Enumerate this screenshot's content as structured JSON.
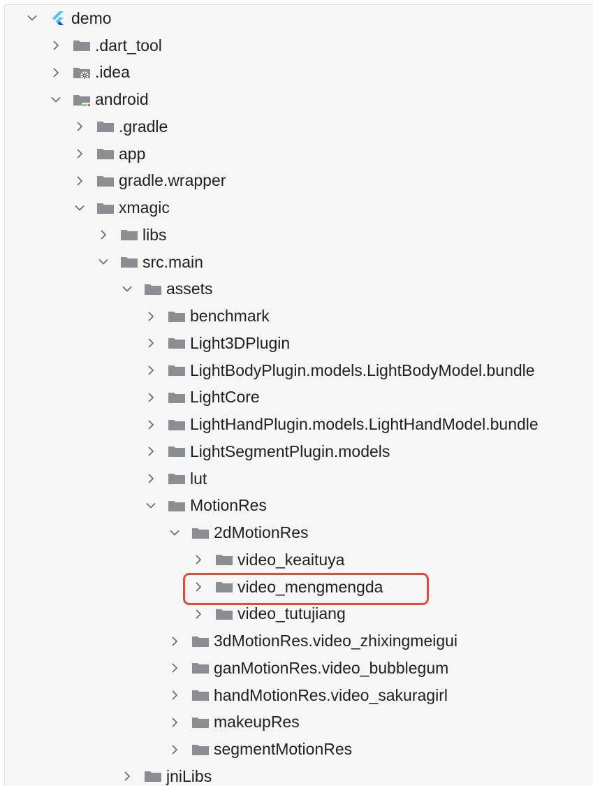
{
  "project_tree": {
    "nodes": [
      {
        "label": "demo",
        "depth": 0,
        "state": "expanded",
        "icon": "flutter-icon"
      },
      {
        "label": ".dart_tool",
        "depth": 1,
        "state": "collapsed",
        "icon": "folder-icon"
      },
      {
        "label": ".idea",
        "depth": 1,
        "state": "collapsed",
        "icon": "folder-settings-icon"
      },
      {
        "label": "android",
        "depth": 1,
        "state": "expanded",
        "icon": "folder-android-icon"
      },
      {
        "label": ".gradle",
        "depth": 2,
        "state": "collapsed",
        "icon": "folder-icon"
      },
      {
        "label": "app",
        "depth": 2,
        "state": "collapsed",
        "icon": "folder-icon"
      },
      {
        "label": "gradle.wrapper",
        "depth": 2,
        "state": "collapsed",
        "icon": "folder-icon"
      },
      {
        "label": "xmagic",
        "depth": 2,
        "state": "expanded",
        "icon": "folder-icon"
      },
      {
        "label": "libs",
        "depth": 3,
        "state": "collapsed",
        "icon": "folder-icon"
      },
      {
        "label": "src.main",
        "depth": 3,
        "state": "expanded",
        "icon": "folder-icon"
      },
      {
        "label": "assets",
        "depth": 4,
        "state": "expanded",
        "icon": "folder-icon"
      },
      {
        "label": "benchmark",
        "depth": 5,
        "state": "collapsed",
        "icon": "folder-icon"
      },
      {
        "label": "Light3DPlugin",
        "depth": 5,
        "state": "collapsed",
        "icon": "folder-icon"
      },
      {
        "label": "LightBodyPlugin.models.LightBodyModel.bundle",
        "depth": 5,
        "state": "collapsed",
        "icon": "folder-icon"
      },
      {
        "label": "LightCore",
        "depth": 5,
        "state": "collapsed",
        "icon": "folder-icon"
      },
      {
        "label": "LightHandPlugin.models.LightHandModel.bundle",
        "depth": 5,
        "state": "collapsed",
        "icon": "folder-icon"
      },
      {
        "label": "LightSegmentPlugin.models",
        "depth": 5,
        "state": "collapsed",
        "icon": "folder-icon"
      },
      {
        "label": "lut",
        "depth": 5,
        "state": "collapsed",
        "icon": "folder-icon"
      },
      {
        "label": "MotionRes",
        "depth": 5,
        "state": "expanded",
        "icon": "folder-icon"
      },
      {
        "label": "2dMotionRes",
        "depth": 6,
        "state": "expanded",
        "icon": "folder-icon"
      },
      {
        "label": "video_keaituya",
        "depth": 7,
        "state": "collapsed",
        "icon": "folder-icon"
      },
      {
        "label": "video_mengmengda",
        "depth": 7,
        "state": "collapsed",
        "icon": "folder-icon",
        "highlighted": true
      },
      {
        "label": "video_tutujiang",
        "depth": 7,
        "state": "collapsed",
        "icon": "folder-icon"
      },
      {
        "label": "3dMotionRes.video_zhixingmeigui",
        "depth": 6,
        "state": "collapsed",
        "icon": "folder-icon"
      },
      {
        "label": "ganMotionRes.video_bubblegum",
        "depth": 6,
        "state": "collapsed",
        "icon": "folder-icon"
      },
      {
        "label": "handMotionRes.video_sakuragirl",
        "depth": 6,
        "state": "collapsed",
        "icon": "folder-icon"
      },
      {
        "label": "makeupRes",
        "depth": 6,
        "state": "collapsed",
        "icon": "folder-icon"
      },
      {
        "label": "segmentMotionRes",
        "depth": 6,
        "state": "collapsed",
        "icon": "folder-icon"
      },
      {
        "label": "jniLibs",
        "depth": 4,
        "state": "collapsed",
        "icon": "folder-icon"
      }
    ]
  },
  "colors": {
    "folder": "#8a8d92",
    "chevron": "#6e6e73",
    "text": "#1f1f1f",
    "highlight_border": "#e8483a",
    "flutter_light": "#54c5f8",
    "flutter_dark": "#0b5aa5",
    "android_badge": "#3ddc84"
  }
}
